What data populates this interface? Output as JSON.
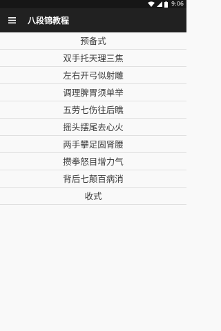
{
  "status_bar": {
    "time": "9:06",
    "icons": [
      "wifi-icon",
      "signal-icon",
      "battery-icon"
    ]
  },
  "toolbar": {
    "menu_icon": "hamburger-menu-icon",
    "title": "八段锦教程"
  },
  "lessons": [
    "预备式",
    "双手托天理三焦",
    "左右开弓似射雕",
    "调理脾胃须单举",
    "五劳七伤往后瞧",
    "摇头摆尾去心火",
    "两手攀足固肾腰",
    "攒拳怒目增力气",
    "背后七颠百病消",
    "收式"
  ],
  "colors": {
    "status_bar_bg": "#161616",
    "toolbar_bg": "#212121",
    "page_bg": "#f9f9f9",
    "divider": "#e0e0e0",
    "item_text": "#3a3a3a"
  }
}
